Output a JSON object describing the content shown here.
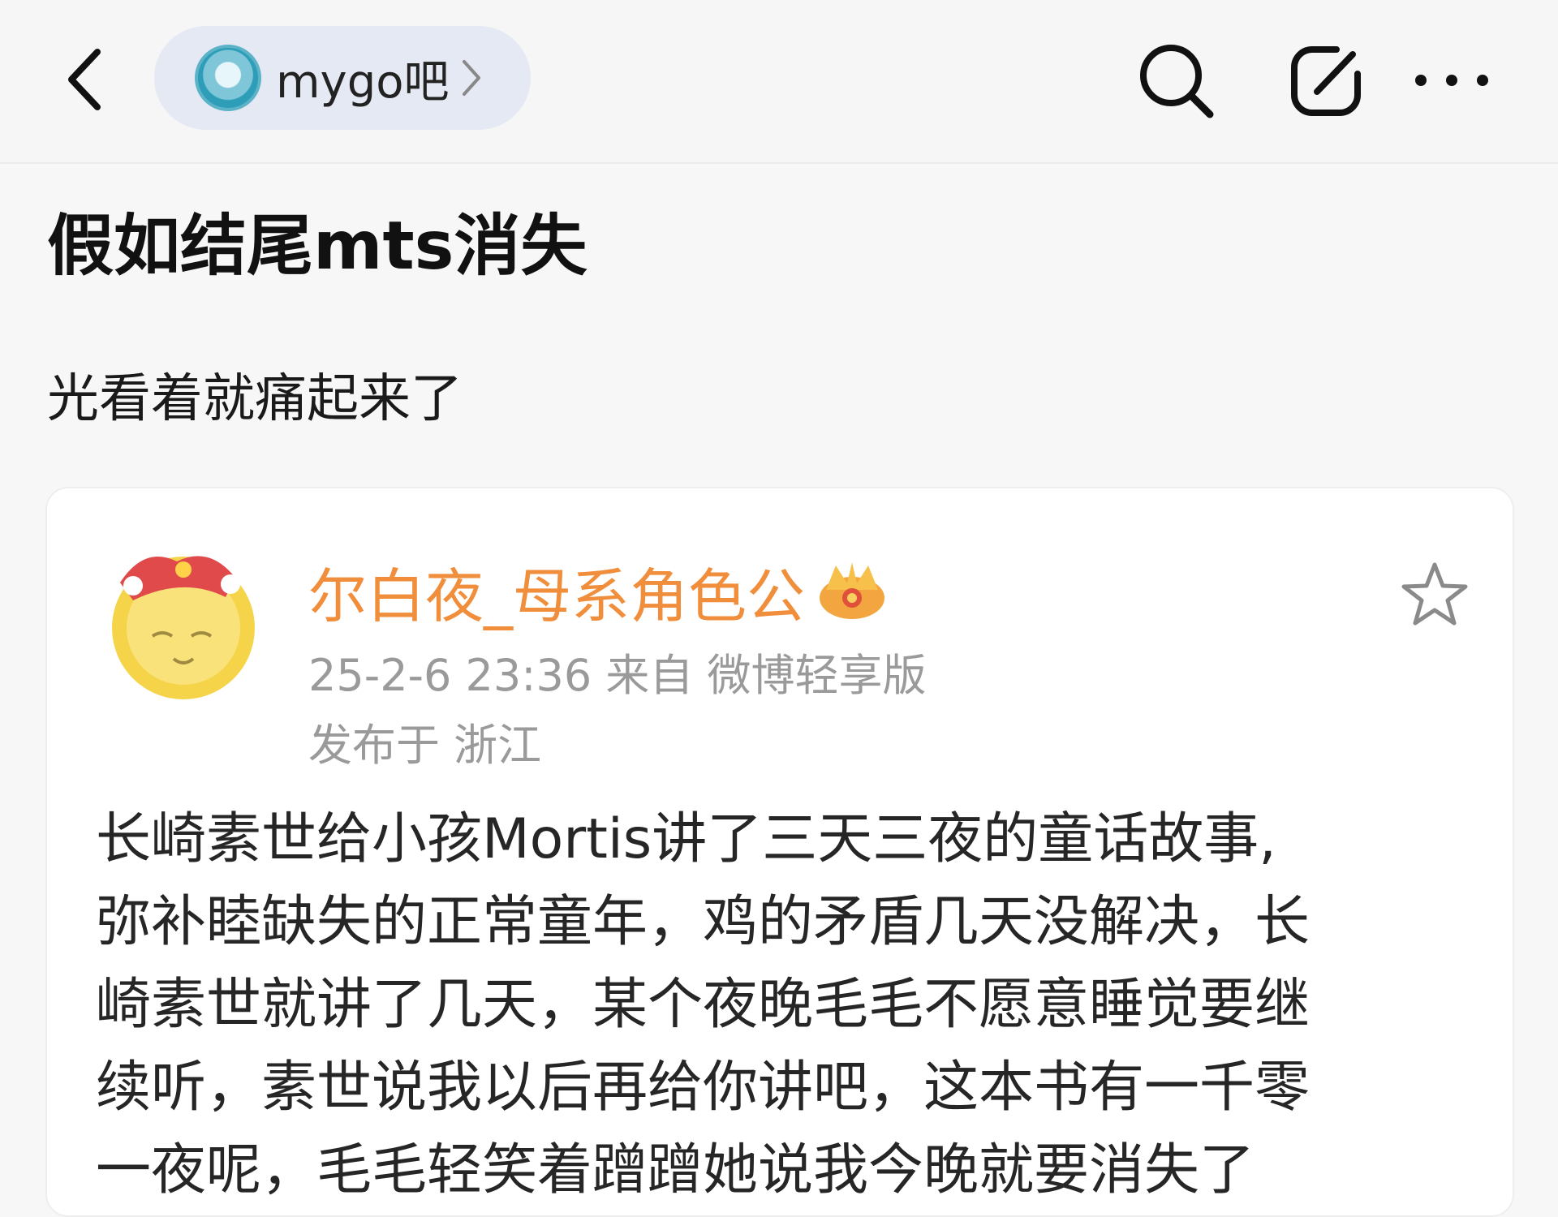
{
  "header": {
    "forum_name": "mygo吧",
    "icons": {
      "back": "chevron-left-icon",
      "forum_chevron": "chevron-right-icon",
      "search": "search-icon",
      "share": "share-icon",
      "more": "more-horizontal-icon"
    }
  },
  "post": {
    "title": "假如结尾mts消失",
    "body": "光看着就痛起来了"
  },
  "embedded_weibo": {
    "username": "尔白夜_母系角色公",
    "meta": "25-2-6 23:36   来自 微博轻享版",
    "location": "发布于 浙江",
    "text_lines": [
      "长崎素世给小孩Mortis讲了三天三夜的童话故事,",
      "弥补睦缺失的正常童年，鸡的矛盾几天没解决，长",
      "崎素世就讲了几天，某个夜晚毛毛不愿意睡觉要继",
      "续听，素世说我以后再给你讲吧，这本书有一千零",
      "一夜呢，毛毛轻笑着蹭蹭她说我今晚就要消失了"
    ],
    "colors": {
      "username": "#f08e3c",
      "meta": "#9a9a9a"
    }
  }
}
